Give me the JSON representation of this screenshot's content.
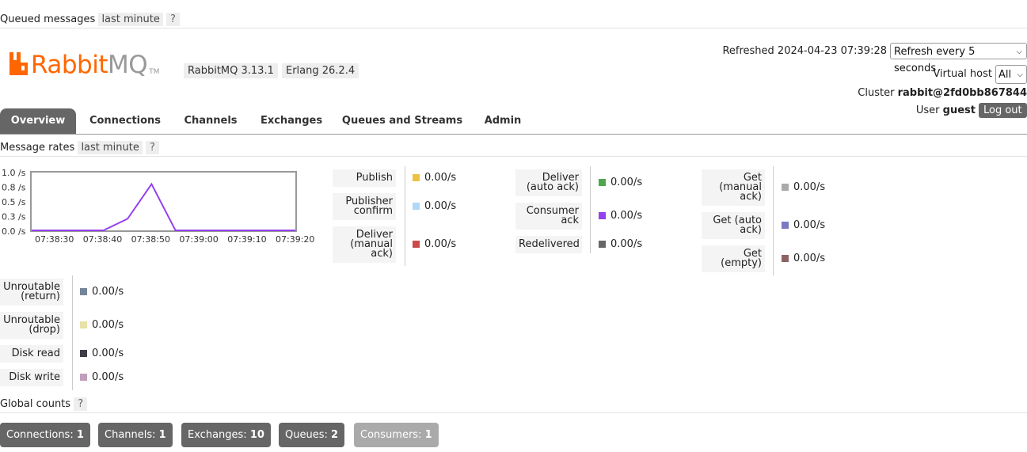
{
  "queued": {
    "title": "Queued messages",
    "range": "last minute",
    "help": "?"
  },
  "logo": {
    "rabbit": "Rabbit",
    "mq": "MQ",
    "tm": "TM"
  },
  "versions": {
    "rabbitmq": "RabbitMQ 3.13.1",
    "erlang": "Erlang 26.2.4"
  },
  "header": {
    "refreshed_label": "Refreshed",
    "refreshed_time": "2024-04-23 07:39:28",
    "refresh_select": "Refresh every 5 seconds",
    "vhost_label": "Virtual host",
    "vhost_select": "All",
    "cluster_label": "Cluster",
    "cluster_name": "rabbit@2fd0bb867844",
    "user_label": "User",
    "user_name": "guest",
    "logout": "Log out"
  },
  "tabs": [
    {
      "label": "Overview",
      "active": true
    },
    {
      "label": "Connections"
    },
    {
      "label": "Channels"
    },
    {
      "label": "Exchanges"
    },
    {
      "label": "Queues and Streams"
    },
    {
      "label": "Admin"
    }
  ],
  "rates": {
    "title": "Message rates",
    "range": "last minute",
    "help": "?",
    "items": [
      {
        "label1": "Publish",
        "value": "0.00/s",
        "color": "#edc240"
      },
      {
        "label1": "Publisher",
        "label2": "confirm",
        "value": "0.00/s",
        "color": "#afd8f8"
      },
      {
        "label1": "Deliver",
        "label2": "(manual",
        "label3": "ack)",
        "value": "0.00/s",
        "color": "#cb4b4b"
      },
      {
        "label1": "Deliver",
        "label2": "(auto ack)",
        "value": "0.00/s",
        "color": "#4da74d"
      },
      {
        "label1": "Consumer",
        "label2": "ack",
        "value": "0.00/s",
        "color": "#9440ed"
      },
      {
        "label1": "Redelivered",
        "value": "0.00/s",
        "color": "#666666"
      },
      {
        "label1": "Get",
        "label2": "(manual",
        "label3": "ack)",
        "value": "0.00/s",
        "color": "#aaaaaa"
      },
      {
        "label1": "Get (auto",
        "label2": "ack)",
        "value": "0.00/s",
        "color": "#7c79c3"
      },
      {
        "label1": "Get",
        "label2": "(empty)",
        "value": "0.00/s",
        "color": "#8d6363"
      },
      {
        "label1": "Unroutable",
        "label2": "(return)",
        "value": "0.00/s",
        "color": "#748599"
      },
      {
        "label1": "Unroutable",
        "label2": "(drop)",
        "value": "0.00/s",
        "color": "#e7e2a8"
      },
      {
        "label1": "Disk read",
        "value": "0.00/s",
        "color": "#3d3d46"
      },
      {
        "label1": "Disk write",
        "value": "0.00/s",
        "color": "#c19fbb"
      }
    ]
  },
  "chart_data": {
    "type": "line",
    "y_ticks": [
      "1.0 /s",
      "0.8 /s",
      "0.5 /s",
      "0.3 /s",
      "0.0 /s"
    ],
    "x_ticks": [
      "07:38:30",
      "07:38:40",
      "07:38:50",
      "07:39:00",
      "07:39:10",
      "07:39:20"
    ],
    "ylim": [
      0,
      1.0
    ],
    "series": [
      {
        "color": "#9440ed",
        "x": [
          0,
          5,
          10,
          15,
          20,
          25,
          30,
          35,
          40,
          45,
          50,
          55
        ],
        "y": [
          0,
          0,
          0,
          0,
          0.2,
          0.8,
          0,
          0,
          0,
          0,
          0,
          0
        ]
      }
    ]
  },
  "global": {
    "title": "Global counts",
    "help": "?",
    "counts": [
      {
        "label": "Connections:",
        "value": "1"
      },
      {
        "label": "Channels:",
        "value": "1"
      },
      {
        "label": "Exchanges:",
        "value": "10"
      },
      {
        "label": "Queues:",
        "value": "2"
      },
      {
        "label": "Consumers:",
        "value": "1"
      }
    ]
  }
}
